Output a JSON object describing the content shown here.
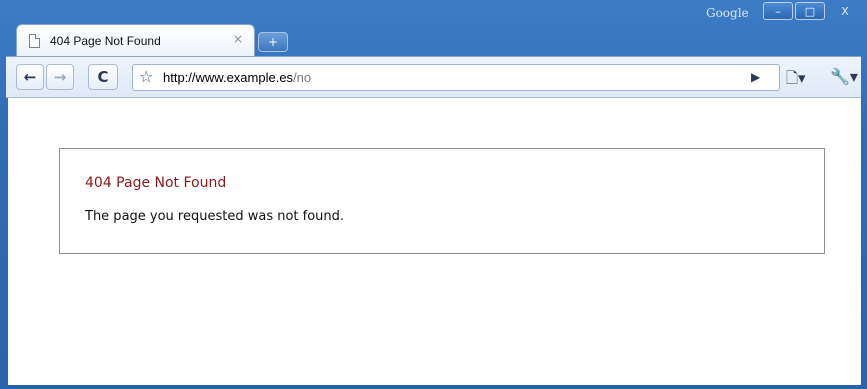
{
  "window": {
    "brand": "Google",
    "buttons": {
      "minimize": "–",
      "maximize": "□",
      "close": "X"
    }
  },
  "tabs": [
    {
      "title": "404 Page Not Found",
      "close": "×"
    }
  ],
  "new_tab_label": "+",
  "toolbar": {
    "back": "←",
    "forward": "→",
    "reload": "C",
    "star": "☆",
    "url_scheme_host": "http://www.example.es",
    "url_path": "/no",
    "go": "▶",
    "page_menu": "🗋▾",
    "wrench_menu": "🔧▾"
  },
  "page": {
    "error_title": "404 Page Not Found",
    "error_message": "The page you requested was not found."
  },
  "colors": {
    "frame": "#2f6cb7",
    "error_title": "#8b1a1a"
  }
}
